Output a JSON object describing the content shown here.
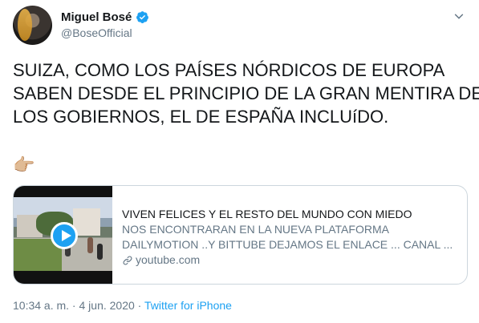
{
  "author": {
    "display_name": "Miguel Bosé",
    "handle": "@BoseOfficial",
    "avatar_icon": "person-portrait",
    "verified_icon": "verified-badge-icon"
  },
  "tweet": {
    "lines": [
      "SUIZA, COMO LOS PAÍSES NÓRDICOS DE EUROPA",
      "SABEN DESDE EL PRINCIPIO DE LA GRAN MENTIRA DE",
      "LOS GOBIERNOS, EL DE ESPAÑA INCLUíDO."
    ],
    "emoji": "👉🏼"
  },
  "card": {
    "title": "VIVEN FELICES Y EL RESTO DEL MUNDO CON MIEDO",
    "description_lines": [
      "NOS ENCONTRARAN EN LA NUEVA PLATAFORMA",
      "DAILYMOTION ..Y BITTUBE DEJAMOS EL ENLACE ... CANAL ..."
    ],
    "domain": "youtube.com",
    "play_icon": "play-icon",
    "link_icon": "link-icon"
  },
  "meta": {
    "time": "10:34 a. m.",
    "separator1": " · ",
    "date": "4 jun. 2020",
    "separator2": " · ",
    "source": "Twitter for iPhone"
  },
  "colors": {
    "accent": "#1da1f2",
    "text": "#14171a",
    "secondary": "#657786",
    "border": "#ccd6dd"
  }
}
